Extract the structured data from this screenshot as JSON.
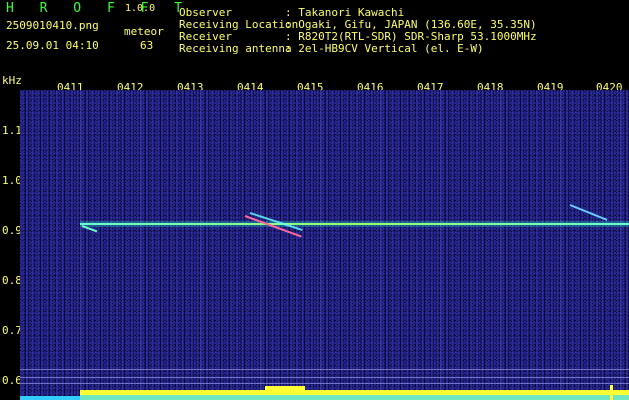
{
  "app": {
    "name": "H R O F F T",
    "version": "1.0.0"
  },
  "image": {
    "filename": "2509010410.png",
    "datetime": "25.09.01 04:10"
  },
  "meteor": {
    "label": "meteor",
    "count": "63"
  },
  "info": [
    {
      "key": "Observer",
      "value": ": Takanori Kawachi"
    },
    {
      "key": "Receiving Location",
      "value": ": Ogaki, Gifu, JAPAN (136.60E, 35.35N)"
    },
    {
      "key": "Receiver",
      "value": ": R820T2(RTL-SDR) SDR-Sharp 53.1000MHz"
    },
    {
      "key": "Receiving antenna",
      "value": ": 2el-HB9CV Vertical (el. E-W)"
    }
  ],
  "axis": {
    "y_unit": "kHz",
    "y_ticks": [
      "1.1",
      "1.0",
      "0.9",
      "0.8",
      "0.7",
      "0.6"
    ],
    "x_ticks": [
      "0411",
      "0412",
      "0413",
      "0414",
      "0415",
      "0416",
      "0417",
      "0418",
      "0419",
      "0420"
    ]
  },
  "colors": {
    "text": "#ffff66",
    "logo": "#33ff33",
    "plot_bg": "#0a0a3a",
    "carrier": "#99ff66"
  }
}
